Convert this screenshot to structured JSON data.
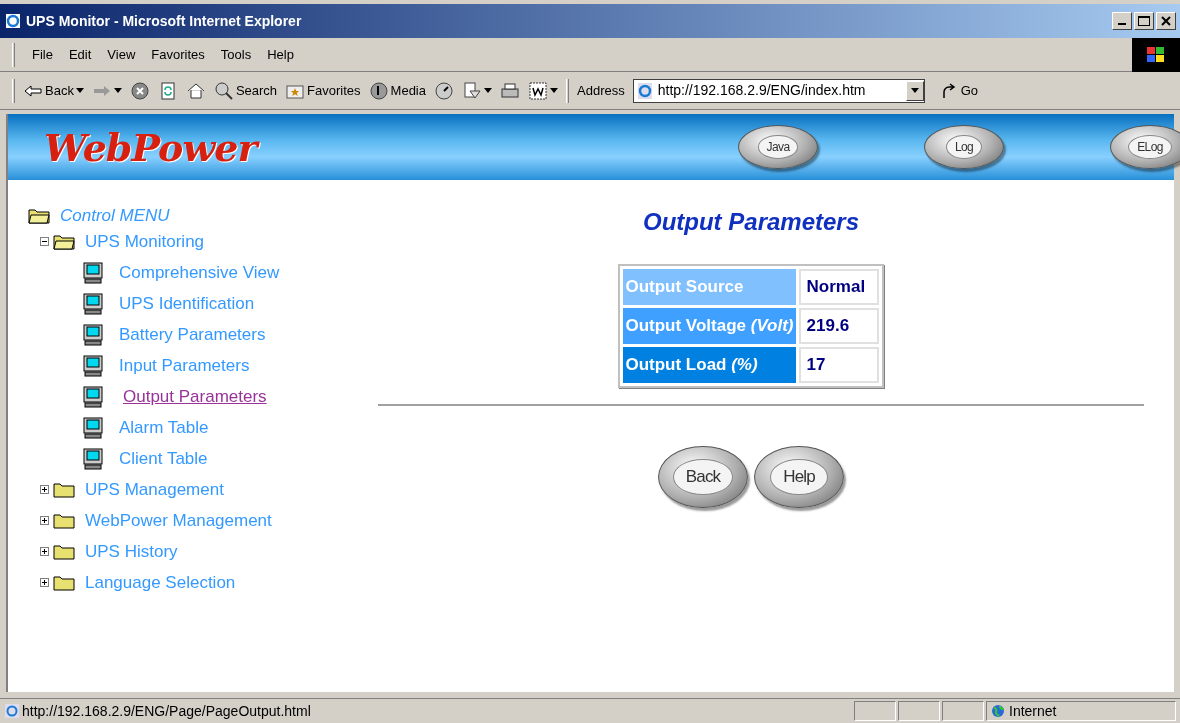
{
  "window": {
    "title": "UPS Monitor - Microsoft Internet Explorer"
  },
  "menu": [
    "File",
    "Edit",
    "View",
    "Favorites",
    "Tools",
    "Help"
  ],
  "toolbar": [
    {
      "kind": "back",
      "label": "Back"
    },
    {
      "kind": "forward"
    },
    {
      "kind": "stop"
    },
    {
      "kind": "refresh"
    },
    {
      "kind": "home"
    },
    {
      "kind": "search",
      "label": "Search"
    },
    {
      "kind": "favorites",
      "label": "Favorites"
    },
    {
      "kind": "media",
      "label": "Media"
    },
    {
      "kind": "history"
    },
    {
      "kind": "mail"
    },
    {
      "kind": "print"
    },
    {
      "kind": "word"
    }
  ],
  "address": {
    "label": "Address",
    "value": "http://192.168.2.9/ENG/index.htm",
    "go": "Go"
  },
  "banner": {
    "logo": "WebPower",
    "buttons": [
      "Java",
      "Log",
      "ELog"
    ]
  },
  "tree": {
    "label": "Control MENU",
    "children": [
      {
        "label": "UPS Monitoring",
        "expanded": true,
        "children": [
          {
            "label": "Comprehensive View",
            "selected": false
          },
          {
            "label": "UPS Identification",
            "selected": false
          },
          {
            "label": "Battery Parameters",
            "selected": false
          },
          {
            "label": "Input Parameters",
            "selected": false
          },
          {
            "label": "Output Parameters",
            "selected": true
          },
          {
            "label": "Alarm Table",
            "selected": false
          },
          {
            "label": "Client Table",
            "selected": false
          }
        ]
      },
      {
        "label": "UPS Management",
        "expanded": false
      },
      {
        "label": "WebPower Management",
        "expanded": false
      },
      {
        "label": "UPS History",
        "expanded": false
      },
      {
        "label": "Language Selection",
        "expanded": false
      }
    ]
  },
  "heading": "Output Parameters",
  "table": {
    "rows": [
      {
        "label": "Output Source",
        "value": "Normal",
        "color": "#80c0ff"
      },
      {
        "label": "Output Voltage *(Volt)*",
        "value": "219.6",
        "color": "#40a0ff"
      },
      {
        "label": "Output Load *(%)*",
        "value": "17",
        "color": "#0080e0"
      }
    ]
  },
  "buttons": [
    "Back",
    "Help"
  ],
  "status_bar": {
    "url": "http://192.168.2.9/ENG/Page/PageOutput.html",
    "zone": "Internet"
  }
}
